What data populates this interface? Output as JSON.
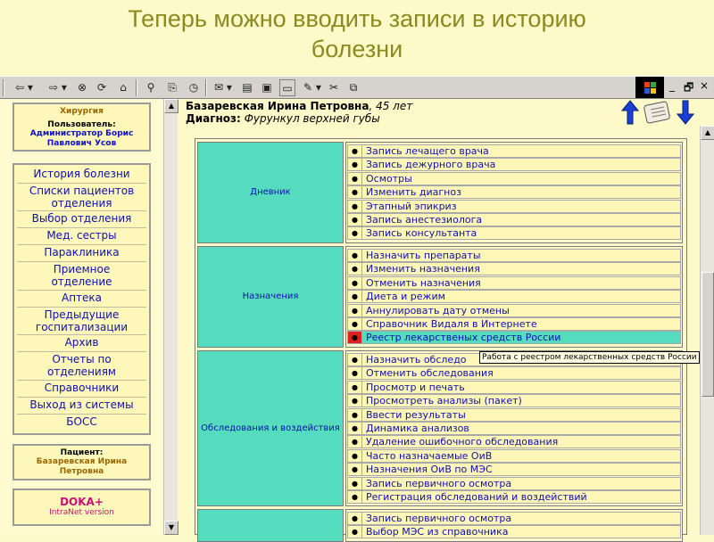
{
  "slide": {
    "title_line1": "Теперь можно вводить записи в историю",
    "title_line2": "болезни"
  },
  "toolbar": {
    "back": "⇦ ▾",
    "forward": "⇨ ▾",
    "stop": "⊗",
    "refresh": "⟳",
    "home": "⌂",
    "search": "⚲",
    "favorites": "⎘",
    "history": "◷",
    "mail": "✉ ▾",
    "print": "▤",
    "edit": "▣",
    "discuss": "✎ ▾",
    "cut": "✂",
    "copy": "⧉",
    "minimize": "_",
    "restore": "🗗",
    "close": "×"
  },
  "sidebar": {
    "department": "Хирургия",
    "user_label": "Пользователь:",
    "user_name_line1": "Администратор Борис",
    "user_name_line2": "Павлович Усов",
    "nav": [
      {
        "l1": "История болезни",
        "l2": ""
      },
      {
        "l1": "Списки пациентов",
        "l2": "отделения"
      },
      {
        "l1": "Выбор отделения",
        "l2": ""
      },
      {
        "l1": "Мед. сестры",
        "l2": ""
      },
      {
        "l1": "Параклиника",
        "l2": ""
      },
      {
        "l1": "Приемное",
        "l2": "отделение"
      },
      {
        "l1": "Аптека",
        "l2": ""
      },
      {
        "l1": "Предыдущие",
        "l2": "госпитализации"
      },
      {
        "l1": "Архив",
        "l2": ""
      },
      {
        "l1": "Отчеты по",
        "l2": "отделениям"
      },
      {
        "l1": "Справочники",
        "l2": ""
      },
      {
        "l1": "Выход из системы",
        "l2": ""
      },
      {
        "l1": "БОСС",
        "l2": ""
      }
    ],
    "patient_label": "Пациент:",
    "patient_line1": "Базаревская Ирина",
    "patient_line2": "Петровна",
    "brand_name": "DOKA+",
    "brand_sub": "IntraNet version"
  },
  "patient": {
    "name": "Базаревская Ирина Петровна",
    "age": ", 45 лет",
    "diag_label": "Диагноз:",
    "diag_value": " Фурункул верхней губы"
  },
  "groups": [
    {
      "name": "Дневник",
      "items": [
        "Запись лечащего врача",
        "Запись дежурного врача",
        "Осмотры",
        "Изменить диагноз",
        "Этапный эпикриз",
        "Запись анестезиолога",
        "Запись консультанта"
      ]
    },
    {
      "name": "Назначения",
      "items": [
        "Назначить препараты",
        "Изменить назначения",
        "Отменить назначения",
        "Диета и режим",
        "Аннулировать дату отмены",
        "Справочник Видаля в Интернете",
        "Реестр лекарственых средств России"
      ]
    },
    {
      "name": "Обследования и воздействия",
      "items": [
        "Назначить обследо",
        "Отменить обследования",
        "Просмотр и печать",
        "Просмотреть анализы (пакет)",
        "Ввести результаты",
        "Динамика анализов",
        "Удаление ошибочного обследования",
        "Часто назначаемые ОиВ",
        "Назначения ОиВ по МЭС",
        "Запись первичного осмотра",
        "Регистрация обследований и воздействий"
      ]
    },
    {
      "name": "",
      "items": [
        "Запись первичного осмотра",
        "Выбор МЭС из справочника"
      ]
    }
  ],
  "bullet": "●",
  "active_item": "Реестр лекарственых средств России",
  "tooltip": "Работа с реестром лекарственных средств России",
  "colors": {
    "category_bg": "#55dbbd",
    "link": "#1010b0",
    "active_marker": "#e02020",
    "slide_bg": "#fdf9c8"
  }
}
